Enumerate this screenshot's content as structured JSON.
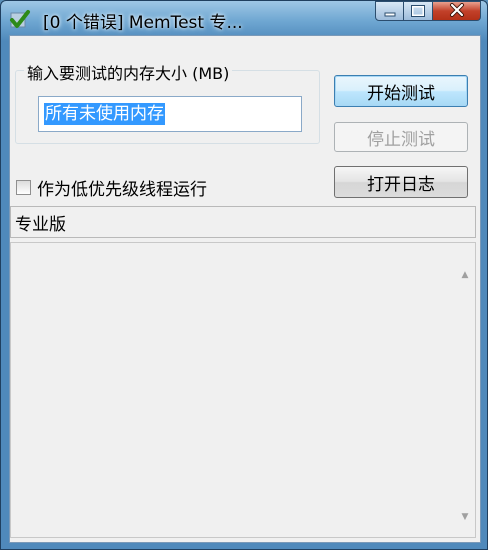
{
  "window": {
    "title": "[0 个错误] MemTest 专...",
    "icon": "memtest-check-icon"
  },
  "caption_buttons": {
    "minimize_icon": "minimize-icon",
    "maximize_icon": "maximize-icon",
    "close_icon": "close-icon"
  },
  "size_group": {
    "label": "输入要测试的内存大小 (MB)",
    "input_value": "所有未使用内存"
  },
  "buttons": {
    "start": "开始测试",
    "stop": "停止测试",
    "open_log": "打开日志"
  },
  "low_priority": {
    "label": "作为低优先级线程运行",
    "checked": false
  },
  "edition_label": "专业版",
  "colors": {
    "selection": "#3399ff",
    "close_button": "#c2412a",
    "titlebar": "#6fa7d2"
  }
}
